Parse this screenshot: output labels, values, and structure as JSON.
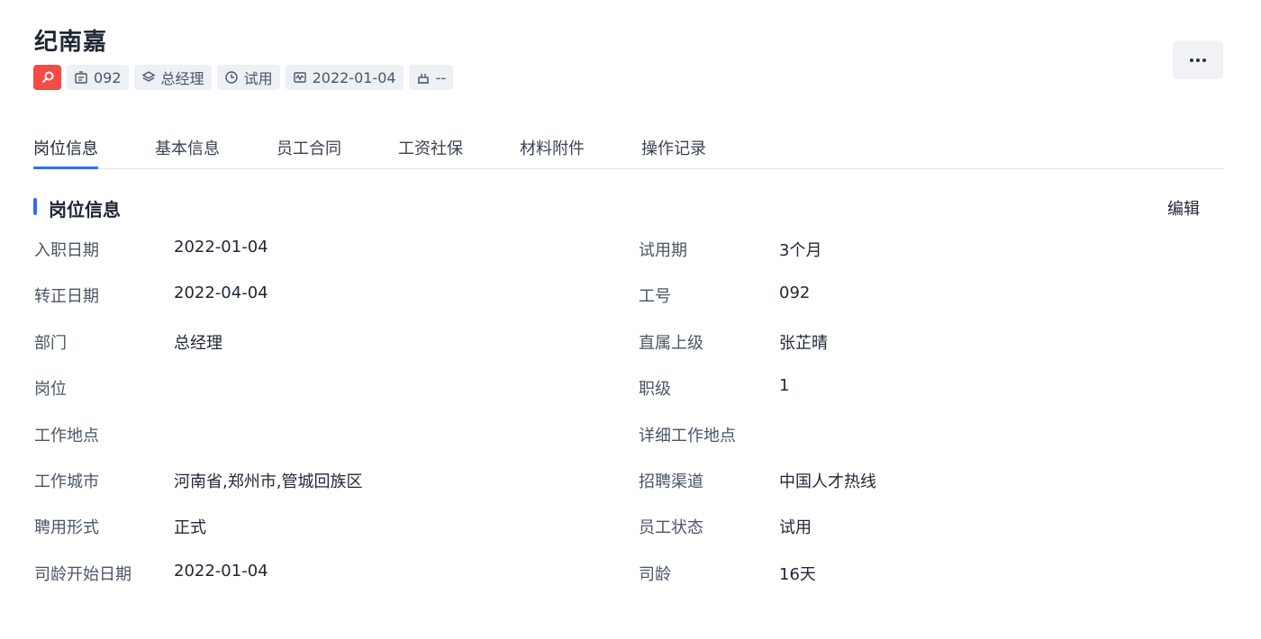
{
  "employee": {
    "name": "纪南嘉",
    "tags": [
      {
        "icon": "id-card-icon",
        "text": "092"
      },
      {
        "icon": "layers-icon",
        "text": "总经理"
      },
      {
        "icon": "clock-icon",
        "text": "试用"
      },
      {
        "icon": "pulse-icon",
        "text": "2022-01-04"
      },
      {
        "icon": "cake-icon",
        "text": "--"
      }
    ],
    "flag_icon": "search-icon",
    "flag_color": "#f54a45"
  },
  "tabs": [
    "岗位信息",
    "基本信息",
    "员工合同",
    "工资社保",
    "材料附件",
    "操作记录"
  ],
  "active_tab": "岗位信息",
  "section": {
    "title": "岗位信息",
    "edit_label": "编辑",
    "left_fields": [
      {
        "label": "入职日期",
        "value": "2022-01-04"
      },
      {
        "label": "转正日期",
        "value": "2022-04-04"
      },
      {
        "label": "部门",
        "value": "总经理"
      },
      {
        "label": "岗位",
        "value": ""
      },
      {
        "label": "工作地点",
        "value": ""
      },
      {
        "label": "工作城市",
        "value": "河南省,郑州市,管城回族区"
      },
      {
        "label": "聘用形式",
        "value": "正式"
      },
      {
        "label": "司龄开始日期",
        "value": "2022-01-04"
      }
    ],
    "right_fields": [
      {
        "label": "试用期",
        "value": "3个月"
      },
      {
        "label": "工号",
        "value": "092"
      },
      {
        "label": "直属上级",
        "value": "张芷晴"
      },
      {
        "label": "职级",
        "value": "1"
      },
      {
        "label": "详细工作地点",
        "value": ""
      },
      {
        "label": "招聘渠道",
        "value": "中国人才热线"
      },
      {
        "label": "员工状态",
        "value": "试用"
      },
      {
        "label": "司龄",
        "value": "16天"
      }
    ]
  },
  "colors": {
    "accent": "#2f6df6",
    "danger": "#f54a45",
    "tag_bg": "#edf0f4"
  }
}
